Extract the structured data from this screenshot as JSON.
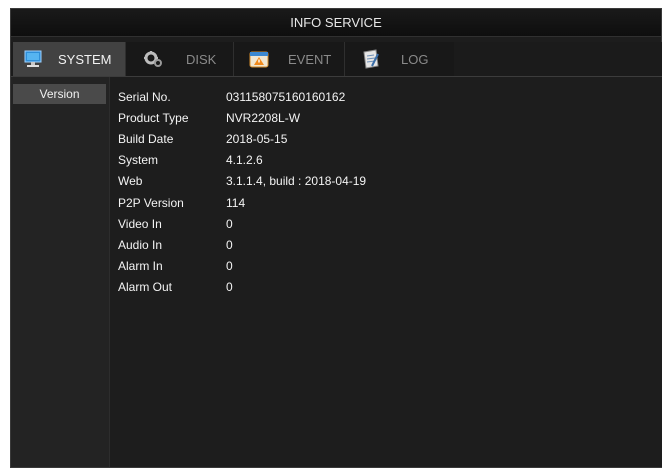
{
  "window": {
    "title": "INFO SERVICE"
  },
  "tabs": [
    {
      "label": "SYSTEM",
      "icon": "monitor-icon",
      "active": true
    },
    {
      "label": "DISK",
      "icon": "gear-icon",
      "active": false
    },
    {
      "label": "EVENT",
      "icon": "warning-icon",
      "active": false
    },
    {
      "label": "LOG",
      "icon": "document-icon",
      "active": false
    }
  ],
  "sidebar": {
    "items": [
      {
        "label": "Version"
      }
    ]
  },
  "info": [
    {
      "key": "Serial No.",
      "value": "031158075160160162"
    },
    {
      "key": "Product Type",
      "value": "NVR2208L-W"
    },
    {
      "key": "Build Date",
      "value": "2018-05-15"
    },
    {
      "key": "System",
      "value": "4.1.2.6"
    },
    {
      "key": "Web",
      "value": "3.1.1.4, build : 2018-04-19"
    },
    {
      "key": "P2P Version",
      "value": "114"
    },
    {
      "key": "Video In",
      "value": "0"
    },
    {
      "key": "Audio In",
      "value": "0"
    },
    {
      "key": "Alarm In",
      "value": "0"
    },
    {
      "key": "Alarm Out",
      "value": "0"
    }
  ]
}
